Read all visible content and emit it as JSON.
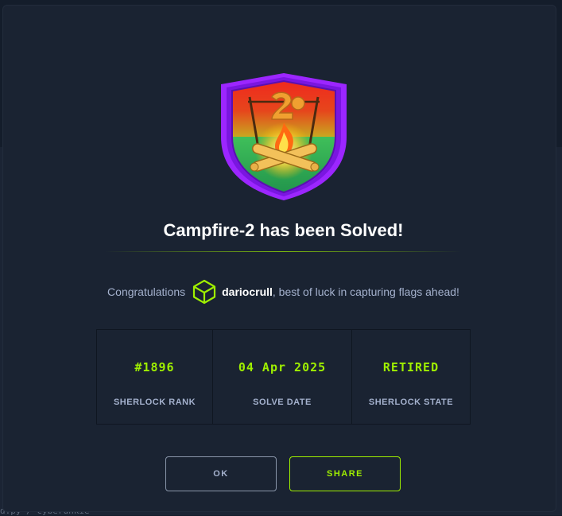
{
  "backdrop": {
    "partial_text": "d.py / cyberunkie"
  },
  "modal": {
    "badge_icon": "campfire-badge-icon",
    "title": "Campfire-2 has been Solved!",
    "congrats": {
      "prefix": "Congratulations",
      "user_icon": "user-cube-icon",
      "username": "dariocrull",
      "suffix": ", best of luck in capturing flags ahead!"
    },
    "stats": [
      {
        "value": "#1896",
        "label": "SHERLOCK RANK"
      },
      {
        "value": "04 Apr 2025",
        "label": "SOLVE DATE"
      },
      {
        "value": "RETIRED",
        "label": "SHERLOCK STATE"
      }
    ],
    "buttons": {
      "ok_label": "OK",
      "share_label": "SHARE"
    }
  },
  "colors": {
    "accent": "#9fef00",
    "background": "#1a2332",
    "muted_text": "#a4b1cd",
    "badge_border": "#9c26ff"
  }
}
